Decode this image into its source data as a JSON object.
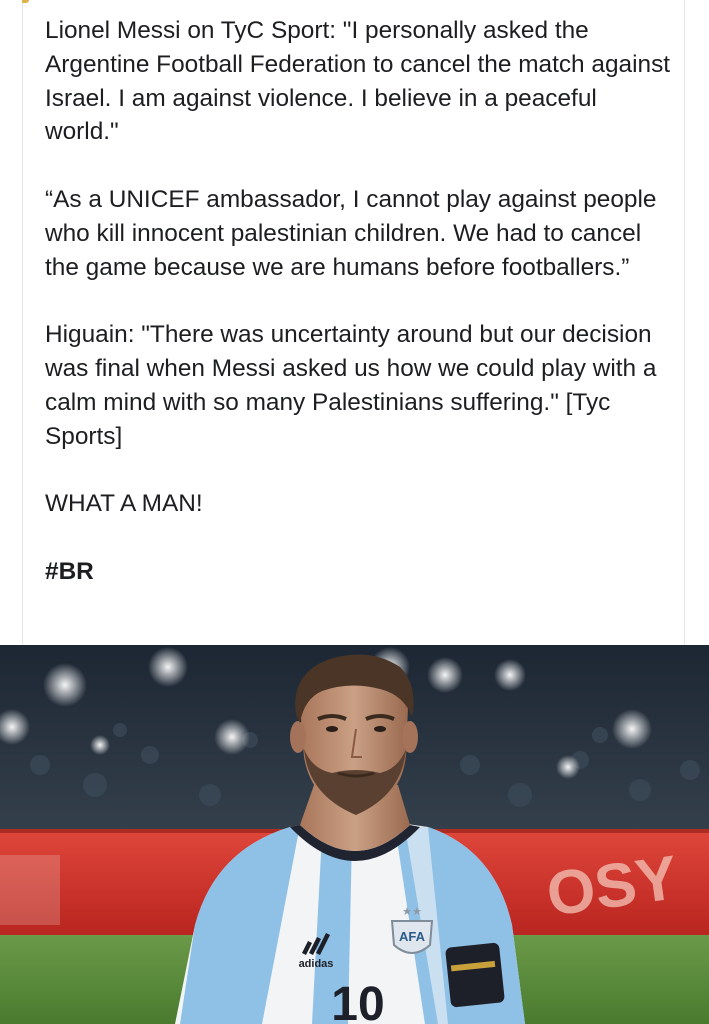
{
  "post": {
    "paragraphs": [
      "Lionel Messi on TyC Sport: \"I personally asked the Argentine Football Federation to cancel the match against Israel. I am against violence. I believe in a peaceful world.\"",
      "“As a UNICEF ambassador, I cannot play against people who kill innocent palestinian children. We had to cancel the game because we are humans before footballers.”",
      "Higuain: \"There was uncertainty around but our decision was final when Messi asked us how we could play with a calm mind with so many Palestinians suffering.\" [Tyc Sports]",
      "WHAT A MAN!"
    ],
    "hashtag": "#BR"
  },
  "photo": {
    "jersey_text": {
      "brand": "adidas",
      "number": "10",
      "crest": "AFA",
      "ad_board": "OSY"
    },
    "colors": {
      "sky_blue": "#8fc0e6",
      "jersey_white": "#f2f4f6",
      "board_red": "#d8322b",
      "pitch_green": "#5b8a3a",
      "stands_dark": "#223040"
    }
  }
}
